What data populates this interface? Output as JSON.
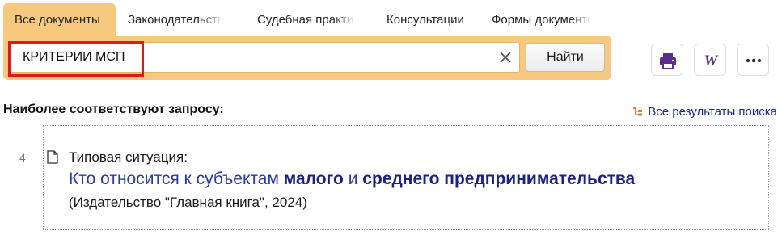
{
  "tabs": [
    {
      "label": "Все документы",
      "active": true
    },
    {
      "label": "Законодательство",
      "active": false
    },
    {
      "label": "Судебная практика",
      "active": false
    },
    {
      "label": "Консультации",
      "active": false
    },
    {
      "label": "Формы документов",
      "active": false
    }
  ],
  "search": {
    "query": "КРИТЕРИИ МСП",
    "button_label": "Найти",
    "clear_icon": "close-icon"
  },
  "toolbar": {
    "print_icon": "printer-icon",
    "word_icon": "word-export-icon",
    "word_letter": "W",
    "more_icon": "more-dots-icon"
  },
  "results": {
    "heading": "Наиболее соответствуют запросу:",
    "all_results_label": "Все результаты поиска",
    "items": [
      {
        "index": "4",
        "type": "Типовая ситуация:",
        "title_parts": [
          "Кто относится к субъектам ",
          "малого",
          " и ",
          "среднего предпринимательства"
        ],
        "source": "(Издательство \"Главная книга\", 2024)"
      }
    ]
  },
  "colors": {
    "accent": "#f7c97e",
    "link": "#2a3aa5",
    "link_bold": "#1c2283",
    "highlight_frame": "#e0171c",
    "tree_icon": "#e8772e"
  }
}
